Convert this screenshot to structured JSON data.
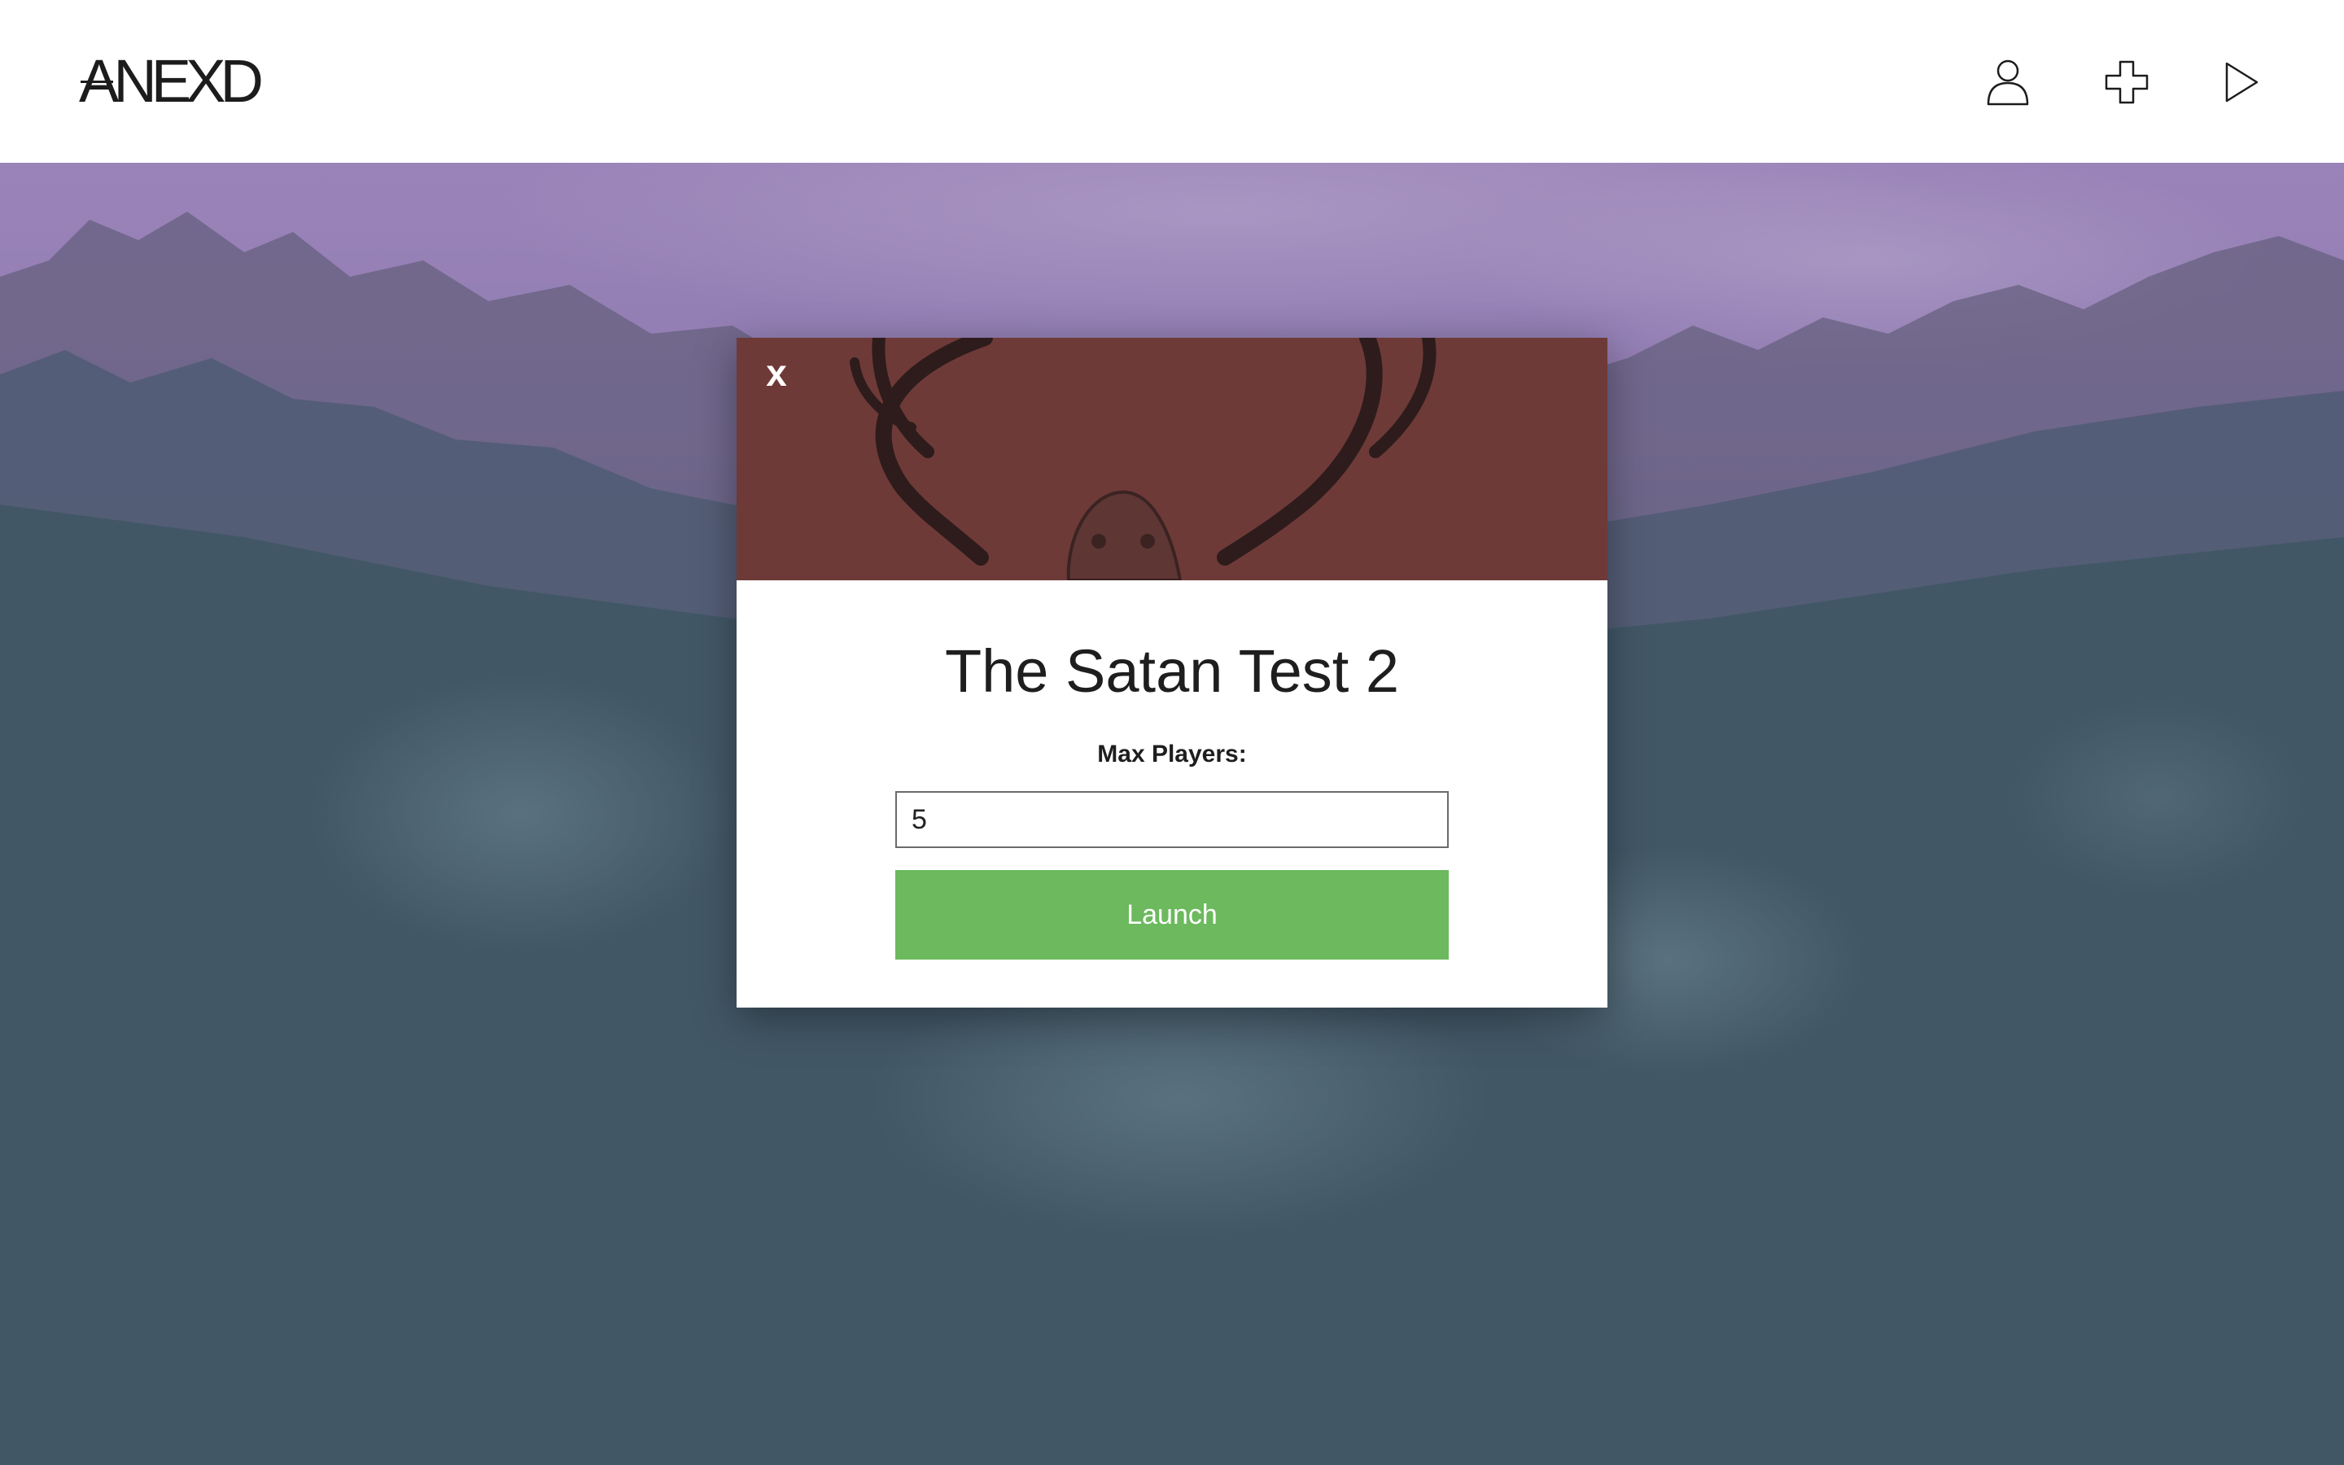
{
  "app": {
    "logo_text": "ANEXD"
  },
  "header": {
    "icons": [
      {
        "name": "profile-icon"
      },
      {
        "name": "add-icon"
      },
      {
        "name": "play-icon"
      }
    ]
  },
  "colors": {
    "accent_green": "#6cb95e",
    "banner_red": "#6e3a38",
    "sky_purple": "#9a83b8",
    "forest_teal": "#3f5664"
  },
  "modal": {
    "close_label": "x",
    "title": "The Satan Test 2",
    "max_players_label": "Max Players:",
    "max_players_value": "5",
    "launch_label": "Launch"
  }
}
